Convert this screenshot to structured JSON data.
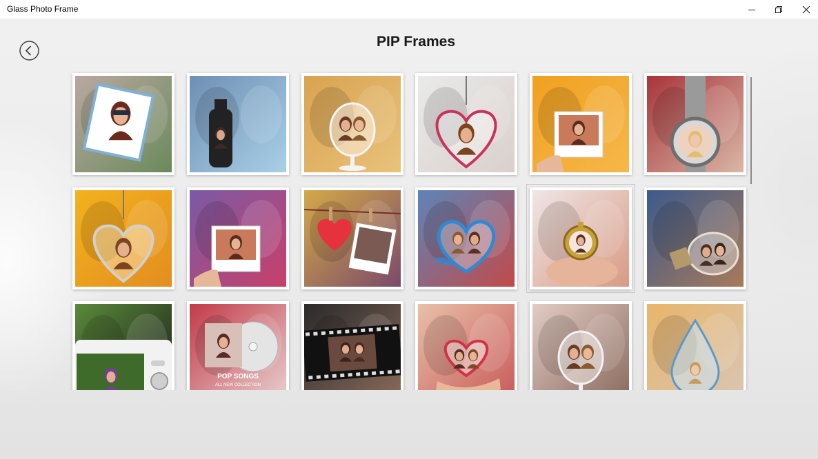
{
  "window": {
    "title": "Glass Photo Frame",
    "buttons": [
      "minimize-icon",
      "restore-icon",
      "close-icon"
    ]
  },
  "header": {
    "title": "PIP Frames",
    "back_icon": "back-arrow-icon"
  },
  "frames": [
    {
      "name": "sunglasses-tilted-frame",
      "bg": [
        "#b9a8a0",
        "#6b8a5c"
      ],
      "accent": "#7fb0d8",
      "shape": "tilted"
    },
    {
      "name": "black-bottle-frame",
      "bg": [
        "#6f8fb5",
        "#a8d0e6"
      ],
      "accent": "#222222",
      "shape": "bottle"
    },
    {
      "name": "wine-glass-frame",
      "bg": [
        "#d9a352",
        "#e9c27a"
      ],
      "accent": "#f4f4f4",
      "shape": "glass"
    },
    {
      "name": "heart-keychain-frame",
      "bg": [
        "#eaeaea",
        "#d9d0cc"
      ],
      "accent": "#c9335a",
      "shape": "heart"
    },
    {
      "name": "polaroid-hand-orange-frame",
      "bg": [
        "#f0a020",
        "#f6b84a"
      ],
      "accent": "#ffffff",
      "shape": "polaroid"
    },
    {
      "name": "wristwatch-frame",
      "bg": [
        "#a8343b",
        "#d9b7a6"
      ],
      "accent": "#b0b0b0",
      "shape": "watch"
    },
    {
      "name": "heart-pendant-frame",
      "bg": [
        "#f2b21e",
        "#e38e1f"
      ],
      "accent": "#d0d0d0",
      "shape": "heart"
    },
    {
      "name": "polaroid-hand-purple-frame",
      "bg": [
        "#7a5aa6",
        "#c8406a"
      ],
      "accent": "#ffffff",
      "shape": "polaroid"
    },
    {
      "name": "clothespin-heart-frame",
      "bg": [
        "#d4a948",
        "#7a4a6a"
      ],
      "accent": "#e6323c",
      "shape": "pins"
    },
    {
      "name": "splash-heart-frame",
      "bg": [
        "#5d84b8",
        "#c24a4a"
      ],
      "accent": "#2f8ad6",
      "shape": "splash"
    },
    {
      "name": "pocket-watch-hand-frame",
      "bg": [
        "#efe6e6",
        "#d89a84"
      ],
      "accent": "#c9a235",
      "shape": "pocketwatch"
    },
    {
      "name": "light-bulb-frame",
      "bg": [
        "#3c5a8c",
        "#a87a5a"
      ],
      "accent": "#e8e0d0",
      "shape": "bulb"
    },
    {
      "name": "camera-screen-frame",
      "bg": [
        "#5a8a3a",
        "#1a1a1a"
      ],
      "accent": "#f2f2f2",
      "shape": "camera"
    },
    {
      "name": "pop-songs-cd-frame",
      "bg": [
        "#c23a48",
        "#e8d0d0"
      ],
      "accent": "#d8d8d8",
      "shape": "cd"
    },
    {
      "name": "film-strip-frame",
      "bg": [
        "#2a2a2a",
        "#8a6a5a"
      ],
      "accent": "#111111",
      "shape": "film"
    },
    {
      "name": "heart-hands-frame",
      "bg": [
        "#e8c0a8",
        "#c85a5a"
      ],
      "accent": "#d23246",
      "shape": "hands"
    },
    {
      "name": "wine-glass-woman-frame",
      "bg": [
        "#e2ccc4",
        "#8a6a5e"
      ],
      "accent": "#f2f2f2",
      "shape": "glass"
    },
    {
      "name": "water-drop-frame",
      "bg": [
        "#e9b56a",
        "#d8c6b4"
      ],
      "accent": "#5a9ac8",
      "shape": "drop"
    }
  ],
  "frame_texts": {
    "cd_line1": "POP SONGS",
    "cd_line2": "ALL NEW COLLECTION"
  },
  "selected_index": 10
}
